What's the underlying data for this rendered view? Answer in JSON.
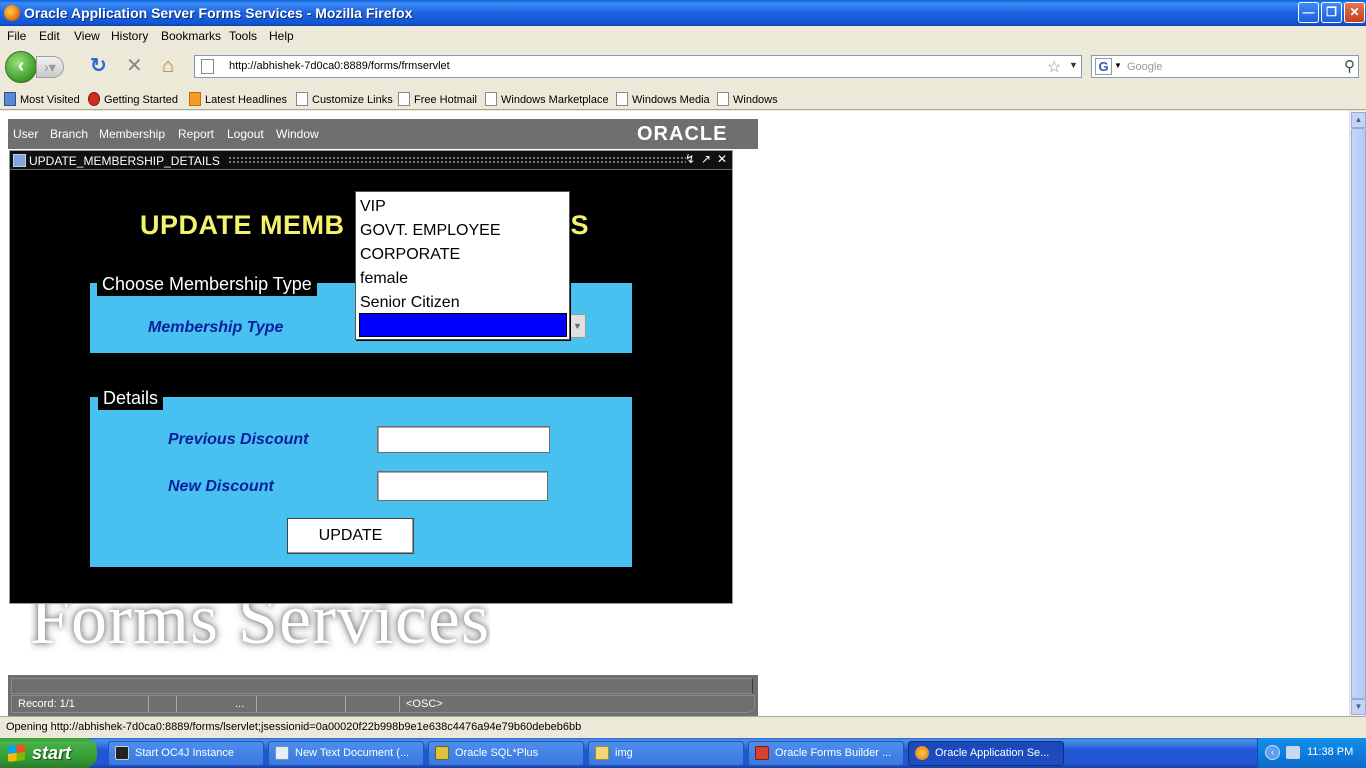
{
  "window": {
    "title": "Oracle Application Server Forms Services - Mozilla Firefox"
  },
  "menubar": [
    "File",
    "Edit",
    "View",
    "History",
    "Bookmarks",
    "Tools",
    "Help"
  ],
  "navigation": {
    "url": "http://abhishek-7d0ca0:8889/forms/frmservlet",
    "search_placeholder": "Google"
  },
  "bookmarks": [
    "Most Visited",
    "Getting Started",
    "Latest Headlines",
    "Customize Links",
    "Free Hotmail",
    "Windows Marketplace",
    "Windows Media",
    "Windows"
  ],
  "oracle": {
    "menu": [
      "User",
      "Branch",
      "Membership",
      "Report",
      "Logout",
      "Window"
    ],
    "logo": "ORACLE",
    "form_title": "UPDATE_MEMBERSHIP_DETAILS",
    "heading_left": "UPDATE MEMB",
    "heading_right": "S",
    "section1": {
      "title": "Choose Membership Type",
      "label": "Membership Type"
    },
    "dropdown_options": [
      "VIP",
      "GOVT. EMPLOYEE",
      "CORPORATE",
      "female",
      "Senior Citizen",
      ""
    ],
    "section2": {
      "title": "Details",
      "previous_label": "Previous Discount",
      "new_label": "New Discount",
      "previous_value": "",
      "new_value": ""
    },
    "update_button": "UPDATE",
    "watermark": "Forms Services",
    "status": {
      "record": "Record: 1/1",
      "ellipsis": "...",
      "mode": "<OSC>"
    }
  },
  "status_text": "Opening http://abhishek-7d0ca0:8889/forms/lservlet;jsessionid=0a00020f22b998b9e1e638c4476a94e79b60debeb6bb",
  "taskbar": {
    "start": "start",
    "tasks": [
      "Start OC4J Instance",
      "New Text Document (...",
      "Oracle SQL*Plus",
      "img",
      "Oracle Forms Builder ...",
      "Oracle Application Se..."
    ],
    "clock": "11:38 PM"
  },
  "colors": {
    "form_panel": "#48c0f0",
    "heading_yellow": "#f4f16c",
    "label_blue": "#0a1fa0",
    "selected_option": "#0000ff"
  }
}
